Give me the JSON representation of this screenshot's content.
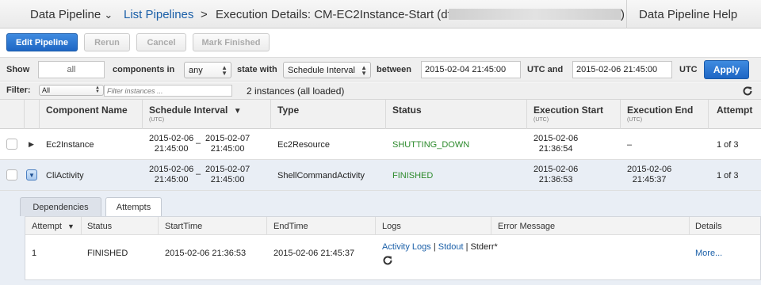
{
  "topbar": {
    "service": "Data Pipeline",
    "service_caret": "⌄",
    "list_link": "List Pipelines",
    "sep": ">",
    "execution_title": "Execution Details: CM-EC2Instance-Start (df-",
    "title_close": ")",
    "help": "Data Pipeline Help"
  },
  "toolbar": {
    "edit": "Edit Pipeline",
    "rerun": "Rerun",
    "cancel": "Cancel",
    "mark_finished": "Mark Finished"
  },
  "filters": {
    "show_label": "Show",
    "show_value": "all",
    "components_label": "components in",
    "components_value": "any",
    "state_label": "state with",
    "state_value": "Schedule Interval",
    "between_label": "between",
    "start_value": "2015-02-04  21:45:00",
    "utc_and": "UTC and",
    "end_value": "2015-02-06  21:45:00",
    "utc": "UTC",
    "apply": "Apply"
  },
  "instances_filter": {
    "label": "Filter:",
    "scope": "All",
    "placeholder": "Filter instances ...",
    "summary": "2 instances (all loaded)"
  },
  "table": {
    "headers": {
      "component": "Component Name",
      "schedule": "Schedule Interval",
      "schedule_sub": "(UTC)",
      "type": "Type",
      "status": "Status",
      "exec_start": "Execution Start",
      "exec_start_sub": "(UTC)",
      "exec_end": "Execution End",
      "exec_end_sub": "(UTC)",
      "attempt": "Attempt"
    },
    "rows": [
      {
        "name": "Ec2Instance",
        "sched_start_date": "2015-02-06",
        "sched_start_time": "21:45:00",
        "dash": "–",
        "sched_end_date": "2015-02-07",
        "sched_end_time": "21:45:00",
        "type": "Ec2Resource",
        "status": "SHUTTING_DOWN",
        "exec_start_date": "2015-02-06",
        "exec_start_time": "21:36:54",
        "exec_end": "–",
        "attempt": "1 of 3"
      },
      {
        "name": "CliActivity",
        "sched_start_date": "2015-02-06",
        "sched_start_time": "21:45:00",
        "dash": "–",
        "sched_end_date": "2015-02-07",
        "sched_end_time": "21:45:00",
        "type": "ShellCommandActivity",
        "status": "FINISHED",
        "exec_start_date": "2015-02-06",
        "exec_start_time": "21:36:53",
        "exec_end_date": "2015-02-06",
        "exec_end_time": "21:45:37",
        "attempt": "1 of 3"
      }
    ]
  },
  "detail": {
    "tabs": [
      "Dependencies",
      "Attempts"
    ],
    "active_tab": "Attempts",
    "headers": {
      "attempt": "Attempt",
      "status": "Status",
      "start": "StartTime",
      "end": "EndTime",
      "logs": "Logs",
      "error": "Error Message",
      "details": "Details"
    },
    "rows": [
      {
        "attempt": "1",
        "status": "FINISHED",
        "start": "2015-02-06 21:36:53",
        "end": "2015-02-06 21:45:37",
        "activity_logs": "Activity Logs",
        "pipe1": "|",
        "stdout": "Stdout",
        "pipe2": "|",
        "stderr": "Stderr*",
        "details": "More..."
      }
    ]
  },
  "icons": {
    "refresh": "refresh-icon",
    "sort_desc": "sort-desc-icon",
    "expand": "expand-row-icon",
    "collapse": "collapse-row-icon"
  },
  "colors": {
    "primary": "#1e66c4",
    "link": "#1a5fa8",
    "success": "#2c8a2c"
  }
}
